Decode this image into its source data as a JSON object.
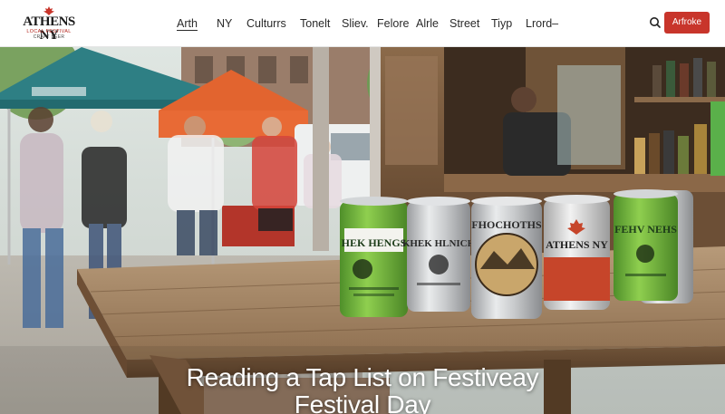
{
  "brand": {
    "logo_title": "ATHENS NY",
    "logo_subtitle": "LOCAL FESTIVAL",
    "logo_tagline": "CRAFT BEER",
    "accent_color": "#c8352b"
  },
  "nav": {
    "items": [
      {
        "label": "Arth",
        "active": true
      },
      {
        "label": "NY",
        "active": false
      },
      {
        "label": "Culturrs",
        "active": false
      },
      {
        "label": "Tonelt",
        "active": false
      },
      {
        "label": "Sliev.",
        "active": false
      },
      {
        "label": "Felore",
        "active": false
      },
      {
        "label": "Alrle",
        "active": false
      },
      {
        "label": "Street",
        "active": false
      },
      {
        "label": "Tiyp",
        "active": false
      },
      {
        "label": "Lrord–",
        "active": false
      }
    ],
    "search_icon": "search-icon",
    "cta_label": "Arfroke"
  },
  "hero": {
    "title_line1": "Reading a Tap List on Festiveay",
    "title_line2": "Festival Day",
    "cans": [
      {
        "label": "HEK HENGS",
        "color": "green"
      },
      {
        "label": "KHEK HLNICH",
        "color": "silver"
      },
      {
        "label": "FHOCHOTHS",
        "color": "silver"
      },
      {
        "label": "ATHENS NY",
        "color": "red"
      },
      {
        "label": "FEHV NEHS",
        "color": "green"
      }
    ]
  }
}
